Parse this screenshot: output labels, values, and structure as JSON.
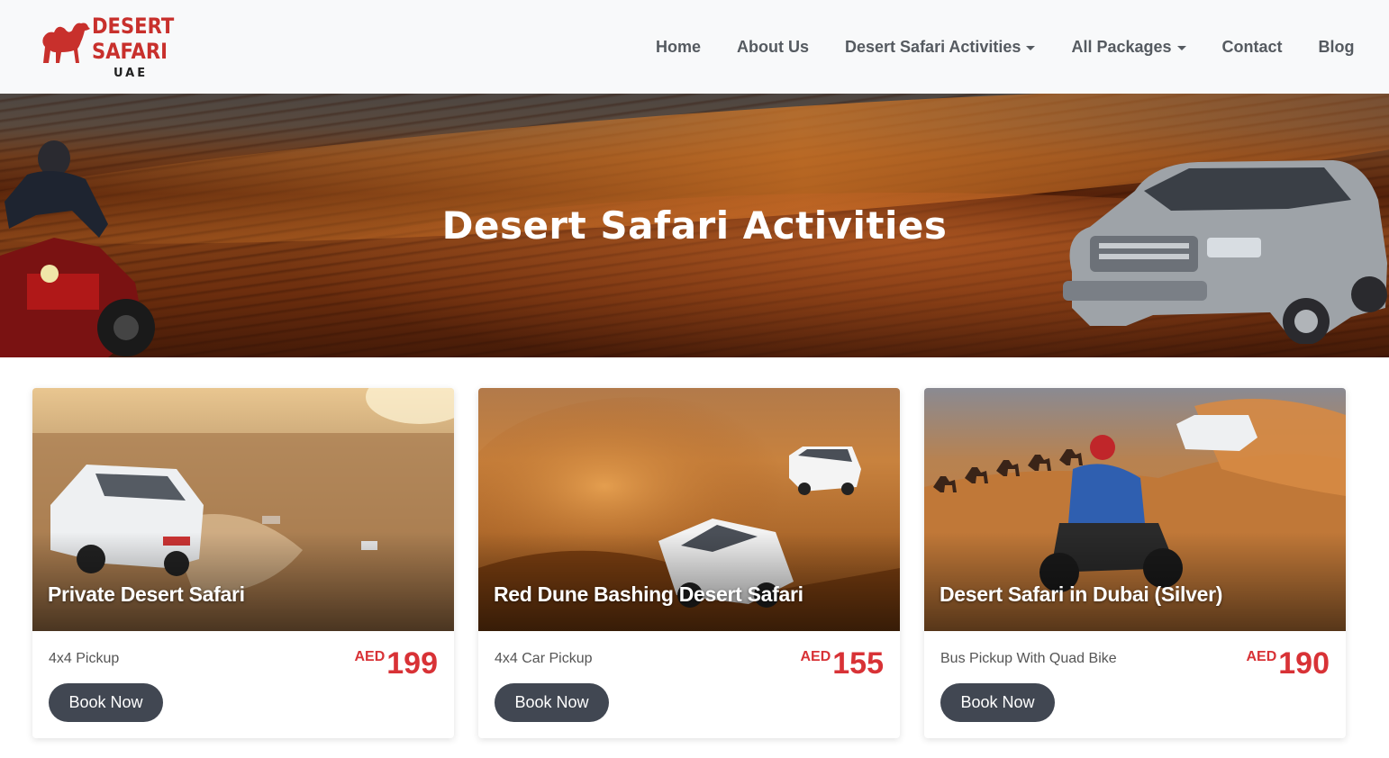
{
  "brand": {
    "line1": "DESERT",
    "line2": "SAFARI",
    "line3": "UAE",
    "color": "#c8302c",
    "icon": "camel-icon"
  },
  "nav": {
    "items": [
      {
        "label": "Home"
      },
      {
        "label": "About Us"
      },
      {
        "label": "Desert Safari Activities",
        "dropdown": true
      },
      {
        "label": "All Packages",
        "dropdown": true
      },
      {
        "label": "Contact"
      },
      {
        "label": "Blog"
      }
    ]
  },
  "hero": {
    "title": "Desert Safari Activities"
  },
  "cards": [
    {
      "title": "Private Desert Safari",
      "subtitle": "4x4 Pickup",
      "currency": "AED",
      "price": "199",
      "button": "Book Now"
    },
    {
      "title": "Red Dune Bashing Desert Safari",
      "subtitle": "4x4 Car Pickup",
      "currency": "AED",
      "price": "155",
      "button": "Book Now"
    },
    {
      "title": "Desert Safari in Dubai (Silver)",
      "subtitle": "Bus Pickup With Quad Bike",
      "currency": "AED",
      "price": "190",
      "button": "Book Now"
    }
  ],
  "colors": {
    "accent_price": "#d83236",
    "button_bg": "#414752",
    "navbar_bg": "#f8f9fa",
    "nav_text": "#555a60"
  }
}
